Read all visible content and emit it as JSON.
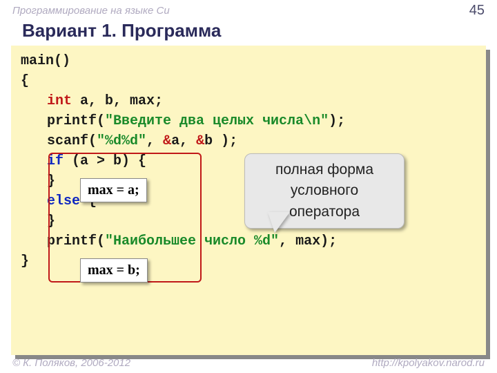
{
  "header": {
    "course": "Программирование на языке Си",
    "page": "45"
  },
  "title": "Вариант 1. Программа",
  "code": {
    "l1_main": "main()",
    "l2_brace": "{",
    "l3_int": "int",
    "l3_vars": " a, b, max;",
    "l4_printf": "printf(",
    "l4_str": "\"Введите два целых числа\\n\"",
    "l4_end": ");",
    "l5_scanf": "scanf(",
    "l5_fmt": "\"%d%d\"",
    "l5_mid": ", ",
    "l5_amp1": "&",
    "l5_a": "a, ",
    "l5_amp2": "&",
    "l5_b": "b );",
    "l6_if": "if",
    "l6_cond": " (a > b) {",
    "l7_blank": " ",
    "l8_close": "   }",
    "l9_else": "else",
    "l9_rest": " {",
    "l10_blank": " ",
    "l11_close": "   }",
    "l12_printf": "printf(",
    "l12_str": "\"Наибольшее число %d\"",
    "l12_end": ", max);",
    "l13_brace": "}"
  },
  "overlays": {
    "max_a": "max = a;",
    "max_b": "max = b;",
    "callout_l1": "полная форма",
    "callout_l2": "условного",
    "callout_l3": "оператора"
  },
  "footer": {
    "copyright": "© К. Поляков, 2006-2012",
    "url": "http://kpolyakov.narod.ru"
  }
}
